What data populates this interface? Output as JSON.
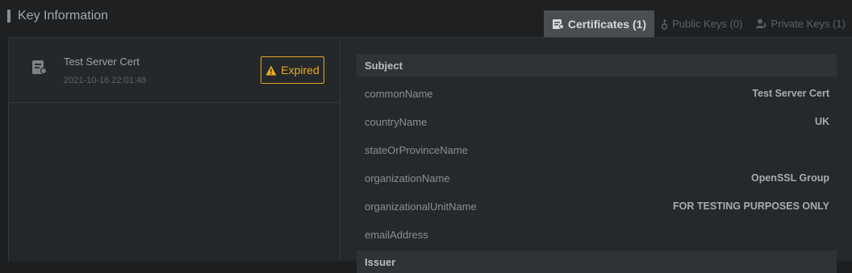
{
  "header": {
    "title": "Key Information"
  },
  "tabs": [
    {
      "label": "Certificates (1)",
      "icon": "certificate-icon",
      "active": true
    },
    {
      "label": "Public Keys (0)",
      "icon": "key-icon",
      "active": false
    },
    {
      "label": "Private Keys (1)",
      "icon": "user-key-icon",
      "active": false
    }
  ],
  "certificates": [
    {
      "name": "Test Server Cert",
      "date": "2021-10-16 22:01:48",
      "status": "Expired"
    }
  ],
  "details": {
    "subject_header": "Subject",
    "fields": [
      {
        "key": "commonName",
        "value": "Test Server Cert"
      },
      {
        "key": "countryName",
        "value": "UK"
      },
      {
        "key": "stateOrProvinceName",
        "value": ""
      },
      {
        "key": "organizationName",
        "value": "OpenSSL Group"
      },
      {
        "key": "organizationalUnitName",
        "value": "FOR TESTING PURPOSES ONLY"
      },
      {
        "key": "emailAddress",
        "value": ""
      }
    ],
    "issuer_header": "Issuer"
  },
  "colors": {
    "warning": "#e9ac25",
    "active_tab_bg": "#4a4e53"
  }
}
